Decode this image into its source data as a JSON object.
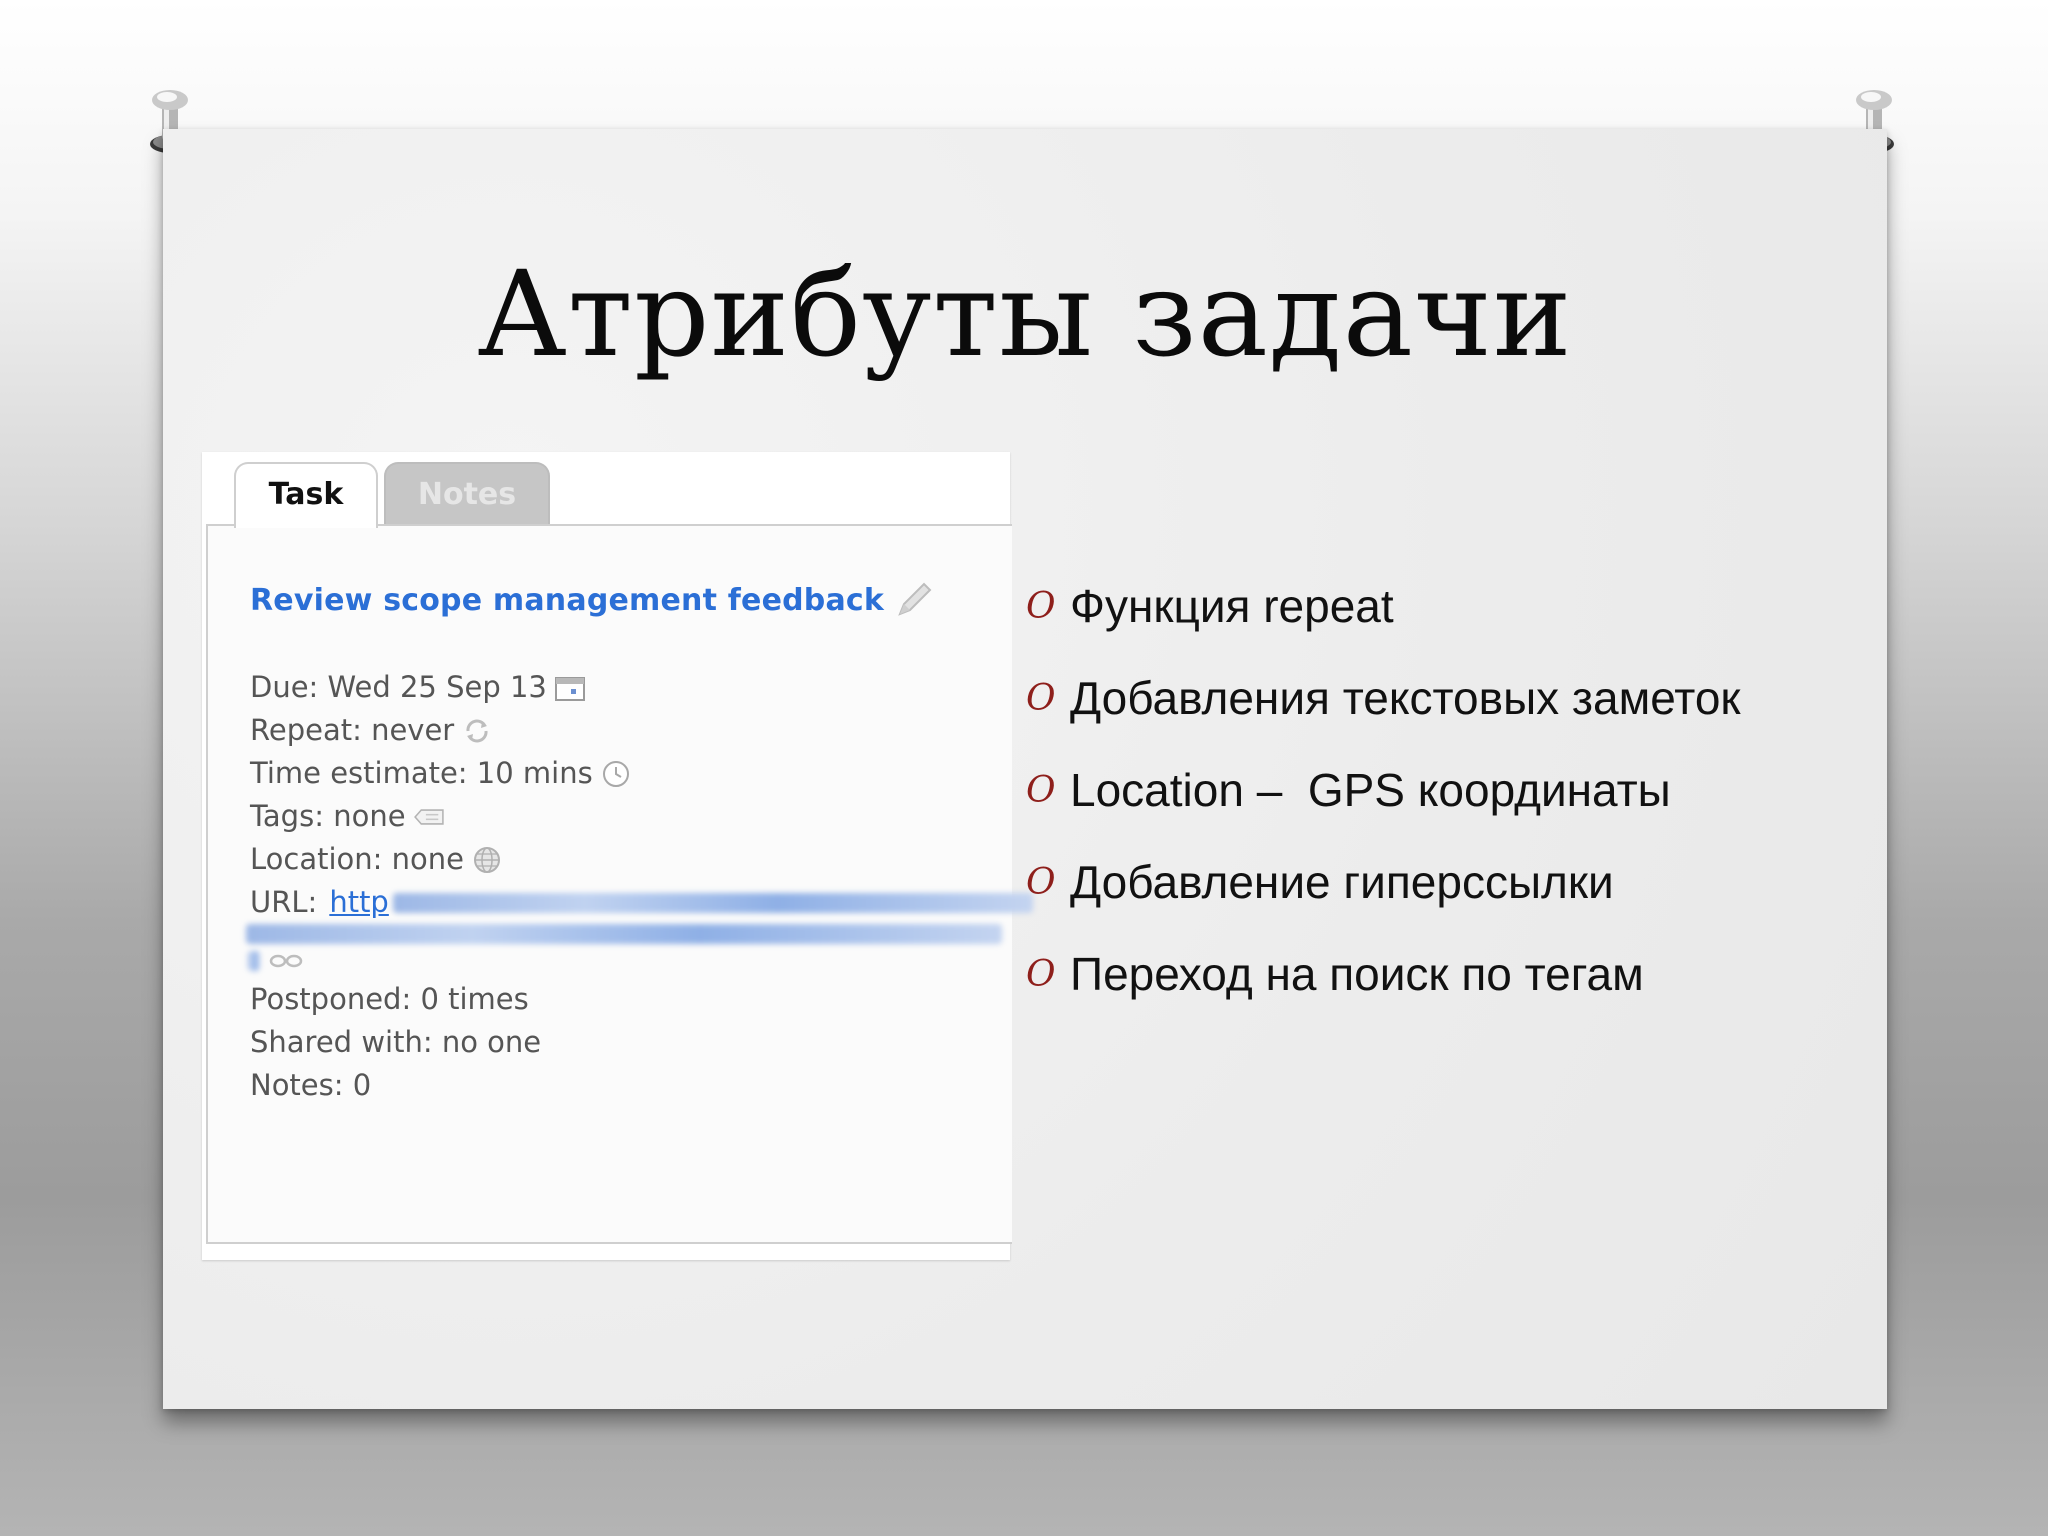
{
  "slide": {
    "title": "Атрибуты задачи"
  },
  "task_screenshot": {
    "tabs": [
      {
        "label": "Task",
        "active": true
      },
      {
        "label": "Notes",
        "active": false
      }
    ],
    "task_title": "Review scope management feedback",
    "attributes": {
      "due": "Due: Wed 25 Sep 13",
      "repeat": "Repeat: never",
      "time_estimate": "Time estimate: 10 mins",
      "tags": "Tags: none",
      "location": "Location: none",
      "url_label": "URL:",
      "url_link_start": "http",
      "postponed": "Postponed: 0 times",
      "shared_with": "Shared with: no one",
      "notes": "Notes: 0"
    },
    "icons": [
      "pencil-icon",
      "calendar-icon",
      "repeat-icon",
      "clock-icon",
      "tag-icon",
      "globe-icon",
      "link-icon"
    ]
  },
  "bullets": [
    "Функция repeat",
    "Добавления текстовых заметок",
    "Location –  GPS координаты",
    "Добавление гиперссылки",
    "Переход на поиск по тегам"
  ],
  "colors": {
    "bullet_mark": "#8e1f1b",
    "link_blue": "#2b6fd6"
  }
}
